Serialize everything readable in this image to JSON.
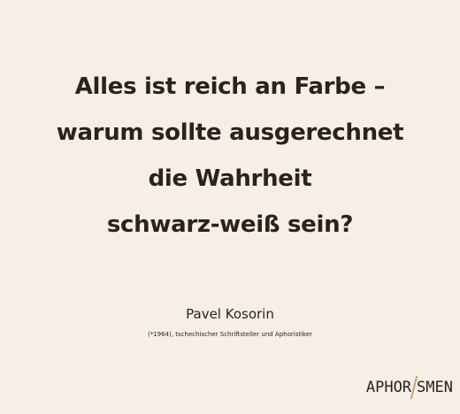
{
  "quote": {
    "lines": [
      "Alles ist reich an Farbe –",
      "warum sollte ausgerechnet",
      "die Wahrheit",
      "schwarz-weiß sein?"
    ]
  },
  "author": {
    "name": "Pavel Kosorin",
    "description": "(*1964), tschechischer Schriftsteller und Aphoristiker"
  },
  "logo": {
    "text": "APHORISMEN",
    "part_left": "APHOR",
    "part_right": "SMEN",
    "accent_color": "#c9a26a"
  },
  "colors": {
    "background": "#f6efe7",
    "text": "#2b2219"
  }
}
